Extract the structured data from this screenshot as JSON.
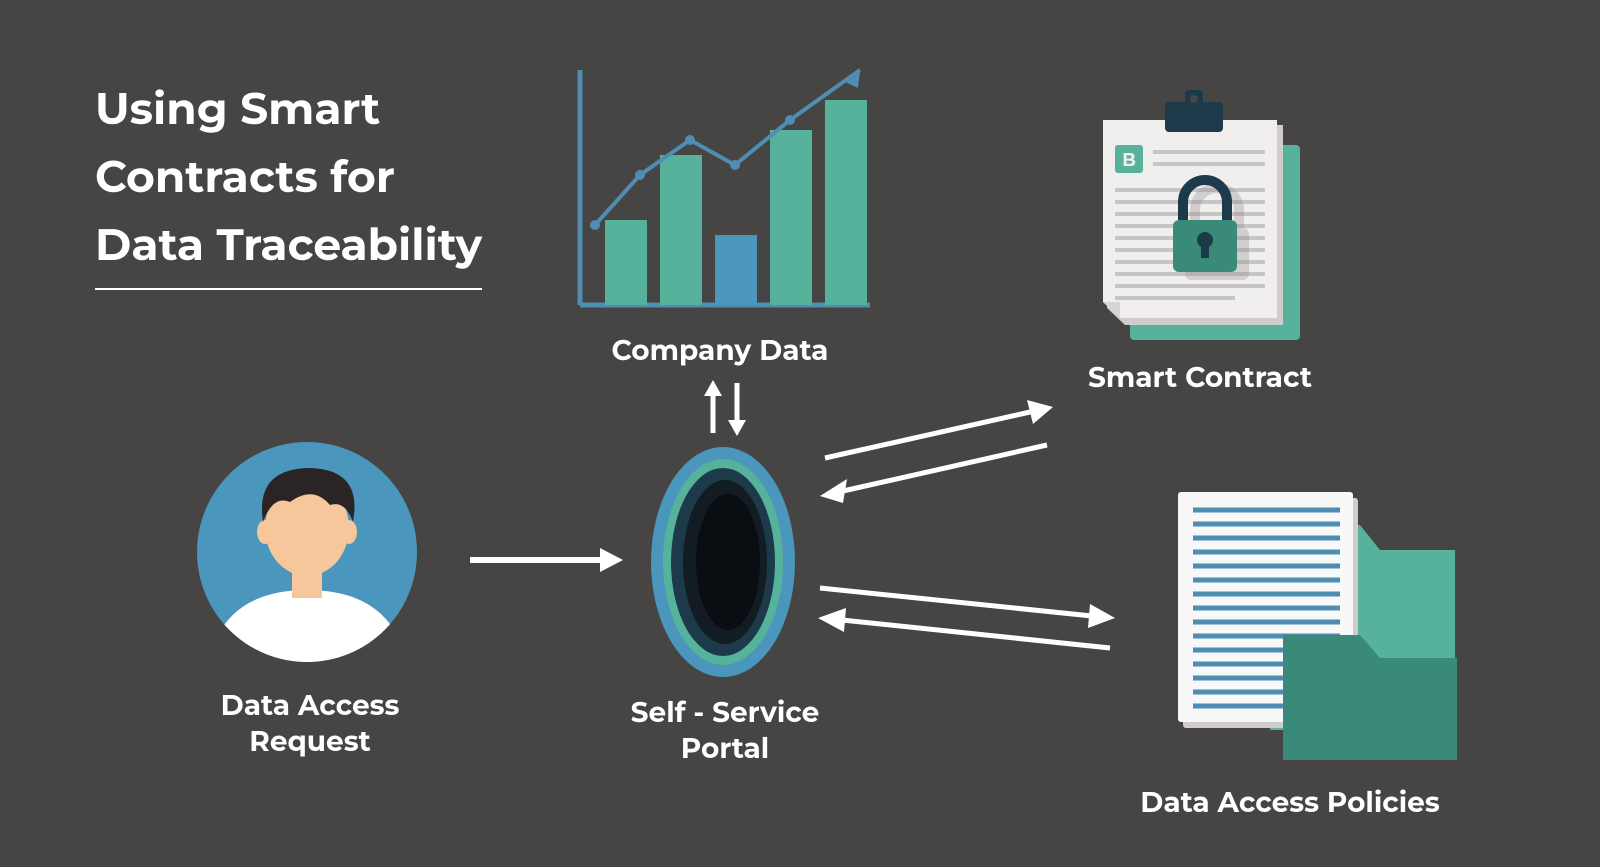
{
  "title": {
    "line1": "Using Smart",
    "line2": "Contracts for",
    "line3": "Data Traceability"
  },
  "nodes": {
    "company_data": "Company Data",
    "smart_contract": "Smart Contract",
    "data_access_request_l1": "Data Access",
    "data_access_request_l2": "Request",
    "self_service_portal_l1": "Self - Service",
    "self_service_portal_l2": "Portal",
    "data_access_policies": "Data Access Policies"
  },
  "colors": {
    "bg": "#474444",
    "text": "#ffffff",
    "teal": "#56b29a",
    "teal_dark": "#3a8a7a",
    "blue": "#4a96bd",
    "blue_line": "#4f8db2",
    "navy": "#1c3a4a",
    "skin": "#f6c79b",
    "hair": "#2a2424",
    "paper": "#f0efee",
    "paper_shadow": "#cfcccb"
  }
}
